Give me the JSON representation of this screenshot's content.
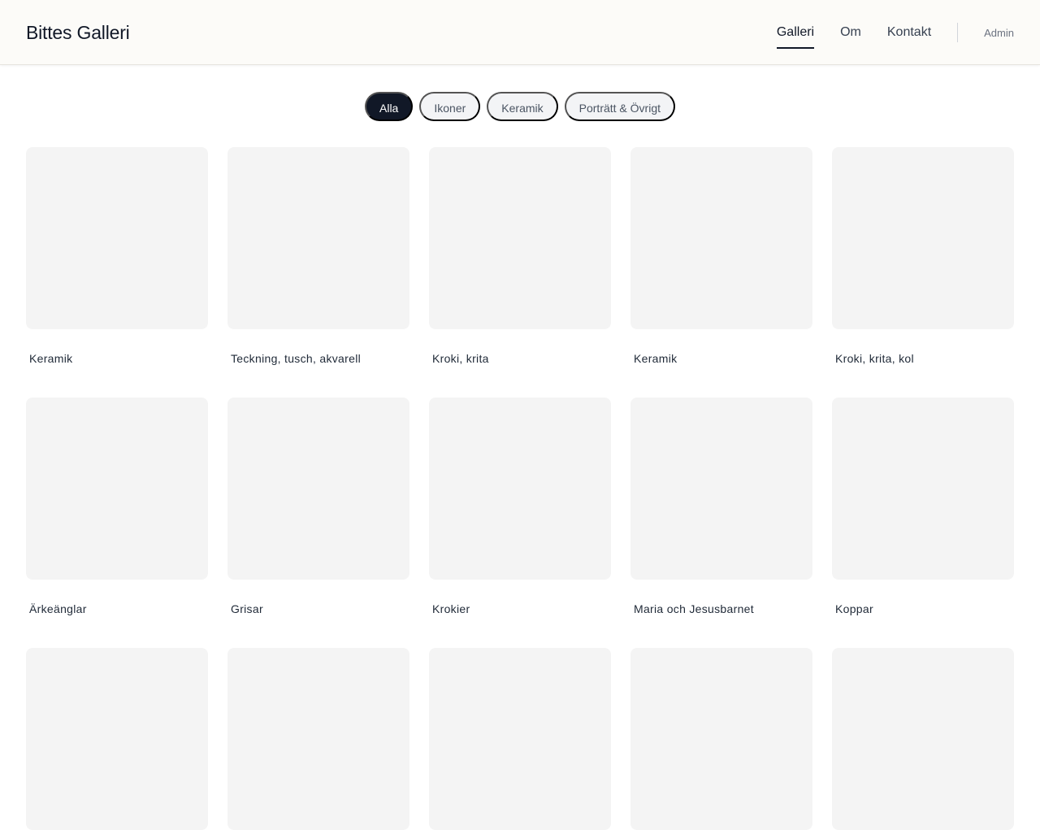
{
  "header": {
    "title": "Bittes Galleri",
    "nav": [
      "Galleri",
      "Om",
      "Kontakt"
    ],
    "active_nav": 0,
    "admin_label": "Admin"
  },
  "filters": {
    "items": [
      "Alla",
      "Ikoner",
      "Keramik",
      "Porträtt & Övrigt"
    ],
    "active": 0
  },
  "gallery": {
    "items": [
      {
        "caption": "Keramik"
      },
      {
        "caption": "Teckning, tusch, akvarell"
      },
      {
        "caption": "Kroki, krita"
      },
      {
        "caption": "Keramik"
      },
      {
        "caption": "Kroki, krita, kol"
      },
      {
        "caption": "Ärkeänglar"
      },
      {
        "caption": "Grisar"
      },
      {
        "caption": "Krokier"
      },
      {
        "caption": "Maria och Jesusbarnet"
      },
      {
        "caption": "Koppar"
      },
      {
        "caption": ""
      },
      {
        "caption": ""
      },
      {
        "caption": ""
      },
      {
        "caption": ""
      },
      {
        "caption": ""
      }
    ]
  },
  "colors": {
    "accent": "#111827",
    "header_bg": "#fcfbf8",
    "card_placeholder": "#f4f4f4",
    "pill_bg": "#f3f4f6"
  }
}
